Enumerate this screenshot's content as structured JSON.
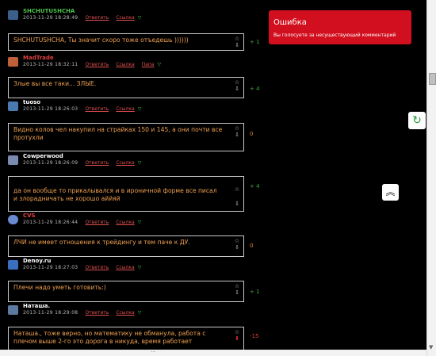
{
  "comments": [
    {
      "author": "SHCHUTUSHCHA",
      "author_color": "#4cc24c",
      "avatar_color": "#3a5f8a",
      "timestamp": "2013-11-29 18:28:49",
      "reply": "Ответить",
      "link": "Ссылка",
      "text": "SHCHUTUSHCHA, Ты значит скоро тоже отъедешь ))))))",
      "score": "+ 1",
      "score_kind": "pos",
      "vote_up": "☆",
      "vote_down": "⇩"
    },
    {
      "author": "MadTrade",
      "author_color": "#e04040",
      "avatar_color": "#c0603a",
      "timestamp": "2013-11-29 18:32:11",
      "reply": "Ответить",
      "link": "Ссылка",
      "extra": "Папа",
      "text": "Злые вы все таки... ЗЛЫЕ.",
      "score": "+ 4",
      "score_kind": "pos",
      "vote_up": "☆",
      "vote_down": "⇩"
    },
    {
      "author": "tuoso",
      "author_color": "#ffffff",
      "avatar_color": "#4a7ab0",
      "timestamp": "2013-11-29 18:26:03",
      "reply": "Ответить",
      "link": "Ссылка",
      "text": "Видно колов чел накупил на страйках 150 и 145, а они почти все протухли",
      "score": "0",
      "score_kind": "zero",
      "vote_up": "☆",
      "vote_down": "⇩"
    },
    {
      "author": "Cowperwood",
      "author_color": "#ffffff",
      "avatar_color": "#7a8ab0",
      "timestamp": "2013-11-29 18:26:09",
      "reply": "Ответить",
      "link": "Ссылка",
      "text": "да он вообще то прикалывался и в ироничной форме все писал\nи злорадничать не хорошо аййяй",
      "score": "+ 4",
      "score_kind": "pos",
      "vote_up": "☆",
      "vote_down": "⇩"
    },
    {
      "author": "CVS",
      "author_color": "#e04040",
      "avatar_color": "#6a8ad0",
      "timestamp": "2013-11-29 18:26:44",
      "reply": "Ответить",
      "link": "Ссылка",
      "text": "ЛЧИ не имеет отношения к трейдингу и тем паче к ДУ.",
      "score": "0",
      "score_kind": "zero",
      "vote_up": "☆",
      "vote_down": "⇩"
    },
    {
      "author": "Denoy.ru",
      "author_color": "#ffffff",
      "avatar_color": "#3a6fc0",
      "timestamp": "2013-11-29 18:27:03",
      "reply": "Ответить",
      "link": "Ссылка",
      "text": "Плечи надо уметь готовить:)",
      "score": "+ 1",
      "score_kind": "pos",
      "vote_up": "☆",
      "vote_down": "⇩"
    },
    {
      "author": "Наташа.",
      "author_color": "#ffffff",
      "avatar_color": "#5a7aa0",
      "timestamp": "2013-11-29 18:29:08",
      "reply": "Ответить",
      "link": "Ссылка",
      "text": "Наташа., тоже верно, но математику не обманула, работа с плечом выше 2-го это дорога в никуда, время работает",
      "score": "-15",
      "score_kind": "neg",
      "vote_up": "☆",
      "vote_down": "⬇"
    }
  ],
  "error_popup": {
    "title": "Ошибка",
    "message": "Вы голосуете за несуществующий комментарий"
  },
  "icons": {
    "refresh": "refresh-icon",
    "scroll_up": "double-chevron-up-icon"
  },
  "colors": {
    "background": "#000000",
    "comment_text": "#f0a050",
    "link": "#e05050",
    "popup_bg": "#d20f1e",
    "positive": "#3ca83c",
    "negative": "#e04040"
  }
}
